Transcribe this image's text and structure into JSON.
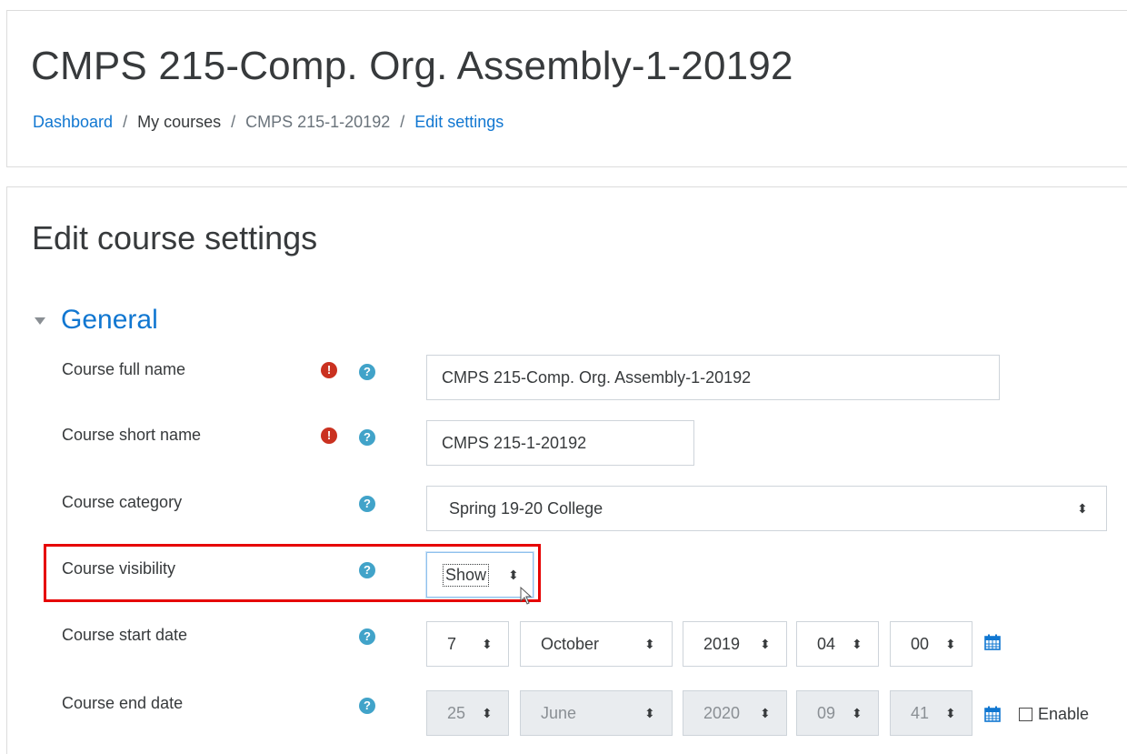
{
  "header": {
    "title": "CMPS 215-Comp. Org. Assembly-1-20192",
    "breadcrumb": [
      "Dashboard",
      "My courses",
      "CMPS 215-1-20192",
      "Edit settings"
    ],
    "separator": "/"
  },
  "page": {
    "heading": "Edit course settings",
    "section_title": "General"
  },
  "icons": {
    "required": "!",
    "help": "?",
    "select_arrow": "⬍",
    "section_toggle": "caret-down-icon",
    "calendar": "calendar-icon",
    "cursor": "mouse-pointer-icon"
  },
  "form": {
    "full_name": {
      "label": "Course full name",
      "value": "CMPS 215-Comp. Org. Assembly-1-20192"
    },
    "short_name": {
      "label": "Course short name",
      "value": "CMPS 215-1-20192"
    },
    "category": {
      "label": "Course category",
      "value": "Spring 19-20 College"
    },
    "visibility": {
      "label": "Course visibility",
      "value": "Show"
    },
    "start_date": {
      "label": "Course start date",
      "day": "7",
      "month": "October",
      "year": "2019",
      "hour": "04",
      "minute": "00"
    },
    "end_date": {
      "label": "Course end date",
      "day": "25",
      "month": "June",
      "year": "2020",
      "hour": "09",
      "minute": "41",
      "enable_label": "Enable",
      "enabled": false
    }
  },
  "colors": {
    "link": "#1177d1",
    "required": "#ca3120",
    "help": "#41a3c9",
    "highlight_box": "#e60000"
  }
}
